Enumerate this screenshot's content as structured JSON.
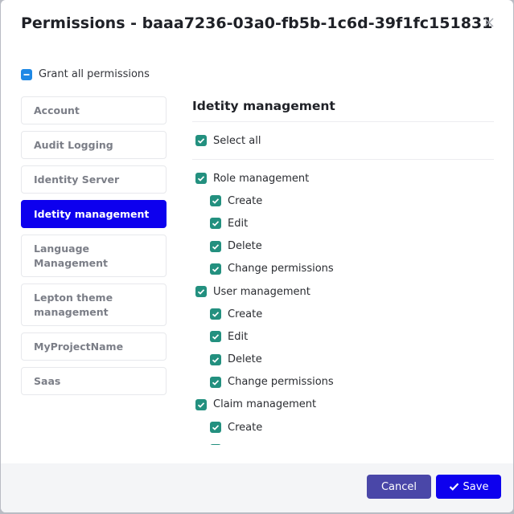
{
  "modal": {
    "title": "Permissions - baaa7236-03a0-fb5b-1c6d-39f1fc151831"
  },
  "grant_all": {
    "label": "Grant all permissions",
    "state": "indeterminate"
  },
  "nav": {
    "items": [
      {
        "label": "Account",
        "active": false
      },
      {
        "label": "Audit Logging",
        "active": false
      },
      {
        "label": "Identity Server",
        "active": false
      },
      {
        "label": "Idetity management",
        "active": true
      },
      {
        "label": "Language Management",
        "active": false
      },
      {
        "label": "Lepton theme management",
        "active": false
      },
      {
        "label": "MyProjectName",
        "active": false
      },
      {
        "label": "Saas",
        "active": false
      }
    ]
  },
  "content": {
    "section_title": "Idetity management",
    "select_all_label": "Select all",
    "permissions": [
      {
        "label": "Role management",
        "level": 0,
        "checked": true
      },
      {
        "label": "Create",
        "level": 1,
        "checked": true
      },
      {
        "label": "Edit",
        "level": 1,
        "checked": true
      },
      {
        "label": "Delete",
        "level": 1,
        "checked": true
      },
      {
        "label": "Change permissions",
        "level": 1,
        "checked": true
      },
      {
        "label": "User management",
        "level": 0,
        "checked": true
      },
      {
        "label": "Create",
        "level": 1,
        "checked": true
      },
      {
        "label": "Edit",
        "level": 1,
        "checked": true
      },
      {
        "label": "Delete",
        "level": 1,
        "checked": true
      },
      {
        "label": "Change permissions",
        "level": 1,
        "checked": true
      },
      {
        "label": "Claim management",
        "level": 0,
        "checked": true
      },
      {
        "label": "Create",
        "level": 1,
        "checked": true
      },
      {
        "label": "",
        "level": 1,
        "checked": true
      }
    ]
  },
  "footer": {
    "cancel_label": "Cancel",
    "save_label": "Save"
  },
  "colors": {
    "primary": "#0d00ee",
    "cancel": "#4a47a8",
    "checkbox": "#23907f",
    "indeterminate": "#1e88e5"
  }
}
